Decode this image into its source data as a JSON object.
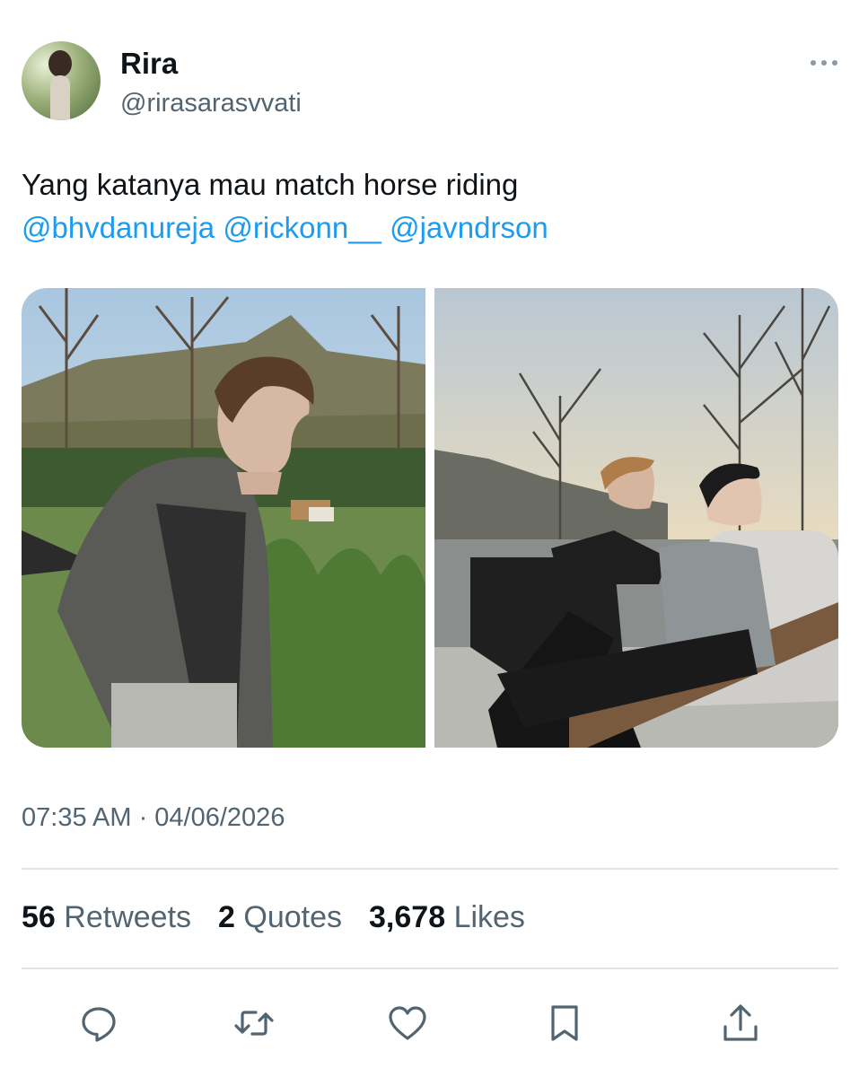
{
  "author": {
    "display_name": "Rira",
    "handle": "@rirasarasvvati"
  },
  "tweet": {
    "text_prefix": "Yang katanya mau match horse riding",
    "mentions": [
      "@bhvdanureja",
      "@rickonn__",
      "@javndrson"
    ]
  },
  "timestamp": "07:35 AM · 04/06/2026",
  "stats": {
    "retweets": {
      "count": "56",
      "label": "Retweets"
    },
    "quotes": {
      "count": "2",
      "label": "Quotes"
    },
    "likes": {
      "count": "3,678",
      "label": "Likes"
    }
  },
  "icons": {
    "more": "more-dots-icon",
    "reply": "reply-bubble-icon",
    "retweet": "retweet-icon",
    "like": "heart-icon",
    "bookmark": "bookmark-icon",
    "share": "share-icon"
  },
  "colors": {
    "link": "#1d9bf0",
    "secondary_text": "#536471",
    "primary_text": "#0f1419",
    "divider": "#dde3e7"
  }
}
